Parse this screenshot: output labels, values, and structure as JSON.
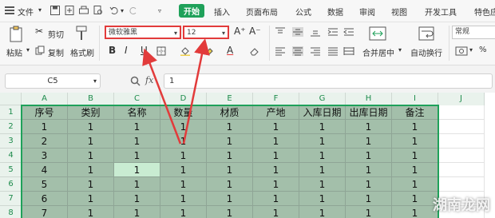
{
  "menubar": {
    "file": "文件",
    "tabs": [
      {
        "label": "开始",
        "active": true
      },
      {
        "label": "插入"
      },
      {
        "label": "页面布局"
      },
      {
        "label": "公式"
      },
      {
        "label": "数据"
      },
      {
        "label": "审阅"
      },
      {
        "label": "视图"
      },
      {
        "label": "开发工具"
      },
      {
        "label": "特色应"
      }
    ],
    "accent": "#1fa15a"
  },
  "ribbon": {
    "cut": "剪切",
    "copy": "复制",
    "paste": "粘贴",
    "format_painter": "格式刷",
    "font_name": "微软雅黑",
    "font_size": "12",
    "bold": "B",
    "italic": "I",
    "underline": "U",
    "merge_center": "合并居中",
    "wrap_text": "自动换行",
    "number_format": "常规",
    "grow_font": "A⁺",
    "shrink_font": "A⁻",
    "highlight_color": "#e23b3b"
  },
  "formula_bar": {
    "cell_ref": "C5",
    "fx": "fx",
    "value": "1"
  },
  "sheet": {
    "columns": [
      "A",
      "B",
      "C",
      "D",
      "E",
      "F",
      "G",
      "H",
      "I",
      "J"
    ],
    "rows": [
      "1",
      "2",
      "3",
      "4",
      "5",
      "6",
      "7",
      "8"
    ],
    "header": [
      "序号",
      "类别",
      "名称",
      "数量",
      "材质",
      "产地",
      "入库日期",
      "出库日期",
      "备注"
    ],
    "data": [
      [
        "1",
        "1",
        "1",
        "1",
        "1",
        "1",
        "1",
        "1",
        "1"
      ],
      [
        "2",
        "1",
        "1",
        "1",
        "1",
        "1",
        "1",
        "1",
        "1"
      ],
      [
        "3",
        "1",
        "1",
        "1",
        "1",
        "1",
        "1",
        "1",
        "1"
      ],
      [
        "4",
        "1",
        "1",
        "1",
        "1",
        "1",
        "1",
        "1",
        "1"
      ],
      [
        "5",
        "1",
        "1",
        "1",
        "1",
        "1",
        "1",
        "1",
        "1"
      ],
      [
        "6",
        "1",
        "1",
        "1",
        "1",
        "1",
        "1",
        "1",
        "1"
      ],
      [
        "7",
        "1",
        "1",
        "1",
        "1",
        "1",
        "1",
        "1",
        "1"
      ]
    ],
    "active_cell": "C5"
  },
  "watermark": "湖南龙网"
}
